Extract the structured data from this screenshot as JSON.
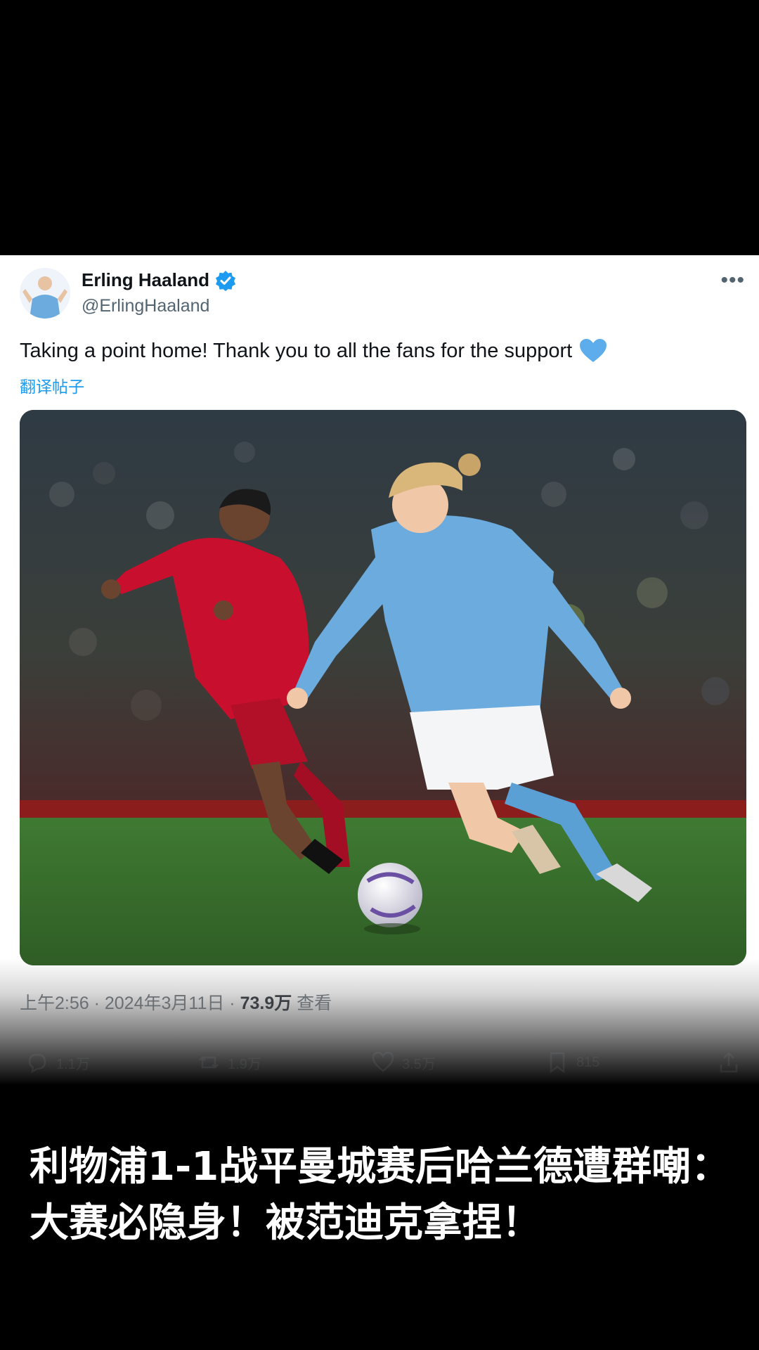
{
  "tweet": {
    "display_name": "Erling Haaland",
    "handle": "@ErlingHaaland",
    "verified": true,
    "more_icon": "ellipsis-icon",
    "text": "Taking a point home! Thank you to all the fans for the support",
    "emoji": "blue-heart-icon",
    "translate_label": "翻译帖子",
    "meta": {
      "time_date": "上午2:56 · 2024年3月11日 · ",
      "views": "73.9万",
      "views_label": " 查看"
    },
    "actions": [
      {
        "icon": "reply-icon",
        "count": "1.1万"
      },
      {
        "icon": "retweet-icon",
        "count": "1.9万"
      },
      {
        "icon": "like-icon",
        "count": "3.5万"
      },
      {
        "icon": "bookmark-icon",
        "count": "815"
      },
      {
        "icon": "share-icon",
        "count": ""
      }
    ]
  },
  "caption": {
    "line1": "利物浦1-1战平曼城赛后哈兰德遭群嘲：",
    "line2": "大赛必隐身！被范迪克拿捏！"
  },
  "colors": {
    "link": "#1d9bf0",
    "liverpool_red": "#c8102e",
    "city_blue": "#6cabdd"
  }
}
